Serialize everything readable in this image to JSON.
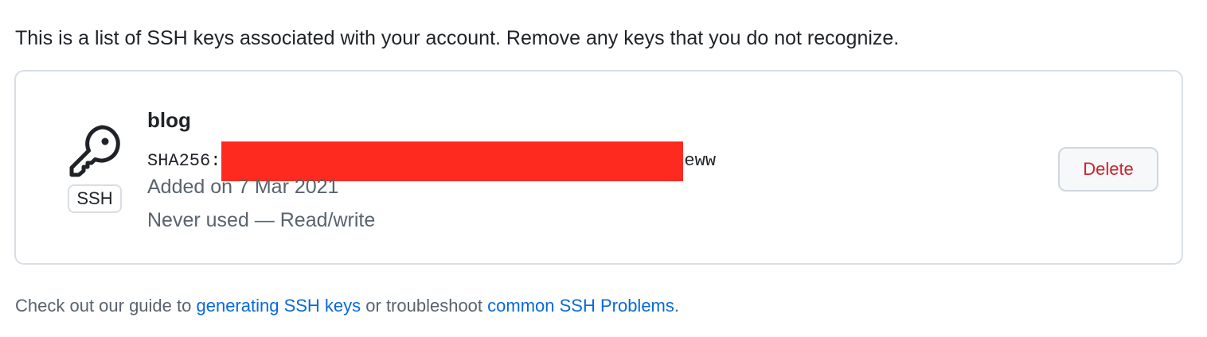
{
  "intro_text": "This is a list of SSH keys associated with your account. Remove any keys that you do not recognize.",
  "key": {
    "title": "blog",
    "type_badge": "SSH",
    "icon": "key-icon",
    "fingerprint_prefix": "SHA256:",
    "fingerprint_suffix": "eww",
    "added": "Added on 7 Mar 2021",
    "usage": "Never used — Read/write",
    "delete_label": "Delete"
  },
  "footer": {
    "text_before": "Check out our guide to ",
    "link1": "generating SSH keys",
    "text_middle": " or troubleshoot ",
    "link2": "common SSH Problems",
    "text_after": "."
  },
  "colors": {
    "link": "#0969da",
    "danger": "#cf222e",
    "muted": "#59636e",
    "redaction": "#ff2a1f"
  }
}
